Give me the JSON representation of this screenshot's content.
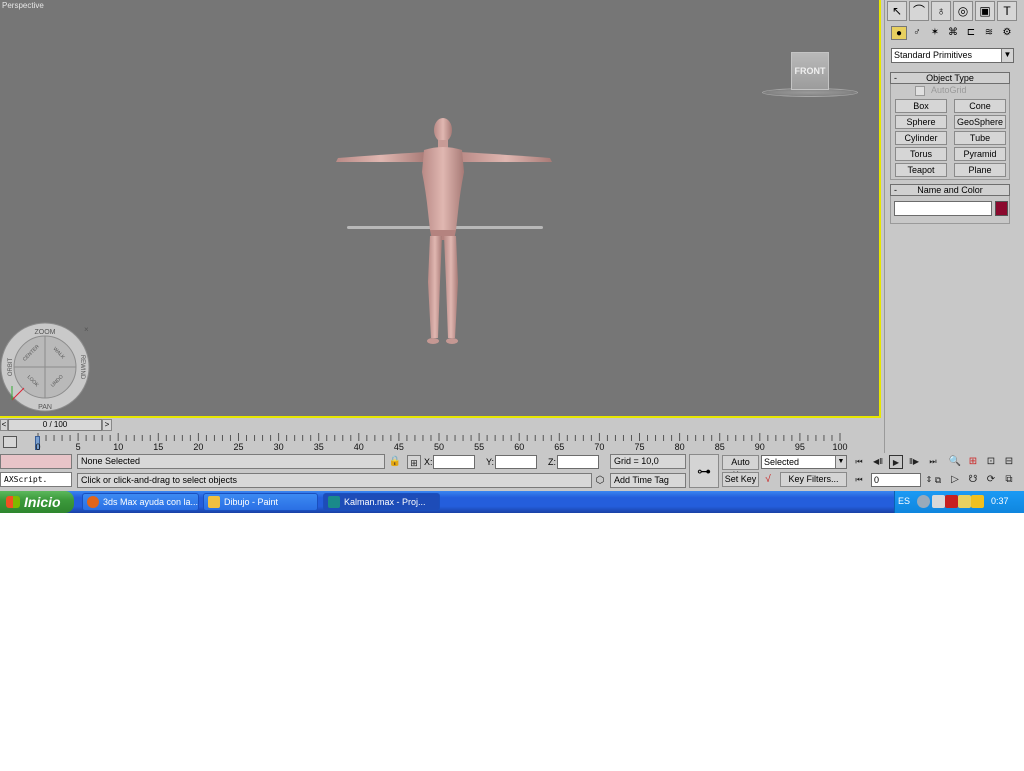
{
  "viewport": {
    "label": "Perspective",
    "viewcube_face": "FRONT"
  },
  "steering_wheel": {
    "zoom": "ZOOM",
    "orbit": "ORBIT",
    "rewind": "REWIND",
    "pan": "PAN",
    "center": "CENTER",
    "walk": "WALK",
    "look": "LOOK",
    "undo": "UNDO"
  },
  "time_slider": {
    "value": "0 / 100",
    "left": "<",
    "right": ">"
  },
  "trackbar": {
    "ticks": [
      "0",
      "5",
      "10",
      "15",
      "20",
      "25",
      "30",
      "35",
      "40",
      "45",
      "50",
      "55",
      "60",
      "65",
      "70",
      "75",
      "80",
      "85",
      "90",
      "95",
      "100"
    ]
  },
  "status": {
    "maxscript": "AXScript.",
    "selection": "None Selected",
    "prompt": "Click or click-and-drag to select objects",
    "x_label": "X:",
    "y_label": "Y:",
    "z_label": "Z:",
    "grid": "Grid = 10,0",
    "add_time_tag": "Add Time Tag",
    "auto_key": "Auto Key",
    "set_key": "Set Key",
    "key_mode": "Selected",
    "key_filters": "Key Filters...",
    "frame": "0"
  },
  "command_panel": {
    "category": "Standard Primitives",
    "object_type_title": "Object Type",
    "autogrid": "AutoGrid",
    "primitives": [
      "Box",
      "Cone",
      "Sphere",
      "GeoSphere",
      "Cylinder",
      "Tube",
      "Torus",
      "Pyramid",
      "Teapot",
      "Plane"
    ],
    "name_color_title": "Name and Color",
    "name_value": "",
    "color": "#8b0a2e",
    "minus": "-"
  },
  "taskbar": {
    "start": "Inicio",
    "tasks": [
      "3ds Max ayuda con la...",
      "Dibujo - Paint",
      "Kalman.max    - Proj..."
    ],
    "lang": "ES",
    "clock": "0:37"
  }
}
